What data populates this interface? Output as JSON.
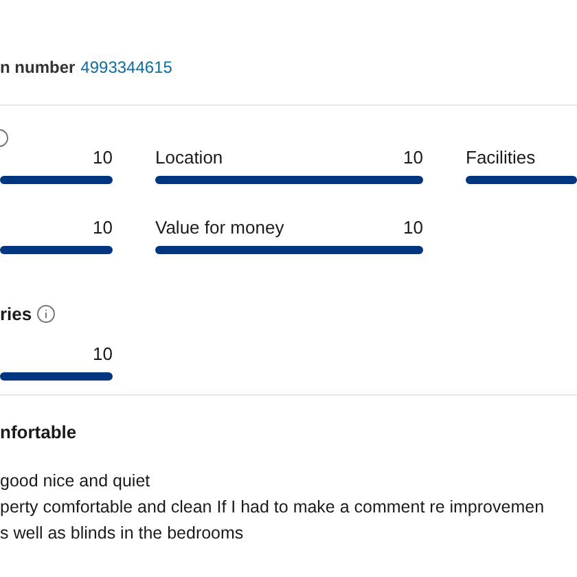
{
  "header": {
    "number_label": "n number",
    "number": "4993344615"
  },
  "scores": {
    "categories": [
      {
        "value": "10"
      },
      {
        "label": "Location",
        "value": "10"
      },
      {
        "label": "Facilities"
      },
      {
        "value": "10"
      },
      {
        "label": "Value for money",
        "value": "10"
      }
    ]
  },
  "wifi": {
    "heading": "ries",
    "categories": [
      {
        "value": "10"
      }
    ]
  },
  "review": {
    "title": "nfortable",
    "lines": [
      "good nice and quiet",
      "perty comfortable and clean If I had to make a comment re improvemen",
      "s well as blinds in the bedrooms"
    ]
  }
}
